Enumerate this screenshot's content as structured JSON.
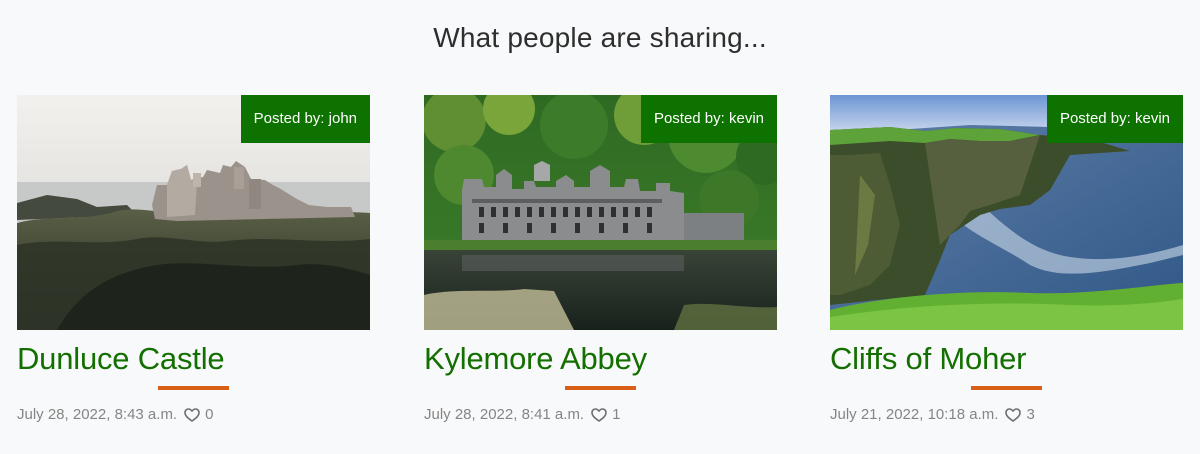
{
  "page": {
    "section_title": "What people are sharing..."
  },
  "cards": [
    {
      "posted_by": "Posted by: john",
      "title": "Dunluce Castle",
      "date": "July 28, 2022, 8:43 a.m.",
      "likes": "0"
    },
    {
      "posted_by": "Posted by: kevin",
      "title": "Kylemore Abbey",
      "date": "July 28, 2022, 8:41 a.m.",
      "likes": "1"
    },
    {
      "posted_by": "Posted by: kevin",
      "title": "Cliffs of Moher",
      "date": "July 21, 2022, 10:18 a.m.",
      "likes": "3"
    }
  ],
  "colors": {
    "posted_badge": "#0d7200",
    "title_green": "#136f00",
    "title_rule": "#d95f16",
    "meta_text": "#858585"
  },
  "icons": {
    "like": "heart-outline-icon"
  }
}
